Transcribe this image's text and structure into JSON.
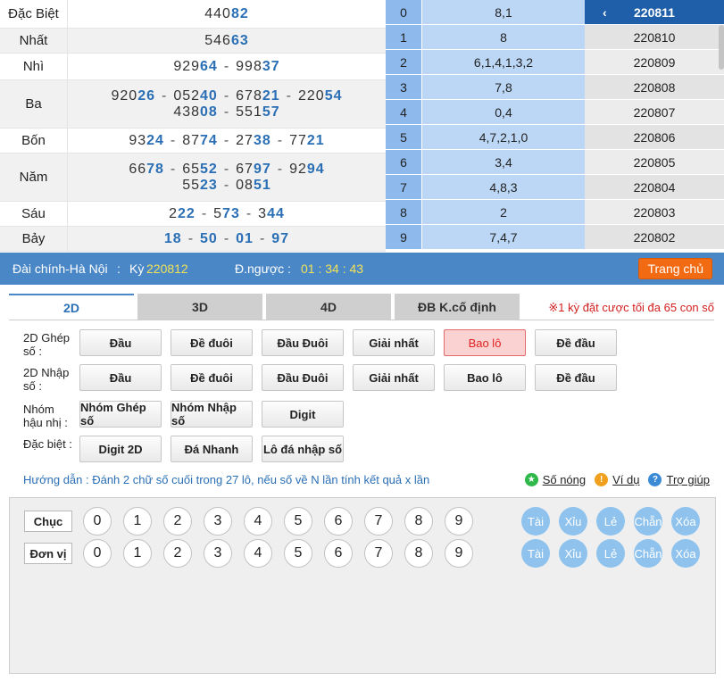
{
  "results": [
    {
      "name": "Đặc Biệt",
      "lines": [
        [
          {
            "pre": "440",
            "post": "82"
          }
        ]
      ]
    },
    {
      "name": "Nhất",
      "lines": [
        [
          {
            "pre": "546",
            "post": "63"
          }
        ]
      ]
    },
    {
      "name": "Nhì",
      "lines": [
        [
          {
            "pre": "929",
            "post": "64"
          },
          {
            "pre": "998",
            "post": "37"
          }
        ]
      ]
    },
    {
      "name": "Ba",
      "lines": [
        [
          {
            "pre": "920",
            "post": "26"
          },
          {
            "pre": "052",
            "post": "40"
          },
          {
            "pre": "678",
            "post": "21"
          },
          {
            "pre": "220",
            "post": "54"
          }
        ],
        [
          {
            "pre": "438",
            "post": "08"
          },
          {
            "pre": "551",
            "post": "57"
          }
        ]
      ]
    },
    {
      "name": "Bốn",
      "lines": [
        [
          {
            "pre": "93",
            "post": "24"
          },
          {
            "pre": "87",
            "post": "74"
          },
          {
            "pre": "27",
            "post": "38"
          },
          {
            "pre": "77",
            "post": "21"
          }
        ]
      ]
    },
    {
      "name": "Năm",
      "lines": [
        [
          {
            "pre": "66",
            "post": "78"
          },
          {
            "pre": "65",
            "post": "52"
          },
          {
            "pre": "67",
            "post": "97"
          },
          {
            "pre": "92",
            "post": "94"
          }
        ],
        [
          {
            "pre": "55",
            "post": "23"
          },
          {
            "pre": "08",
            "post": "51"
          }
        ]
      ]
    },
    {
      "name": "Sáu",
      "lines": [
        [
          {
            "pre": "2",
            "post": "22"
          },
          {
            "pre": "5",
            "post": "73"
          },
          {
            "pre": "3",
            "post": "44"
          }
        ]
      ]
    },
    {
      "name": "Bảy",
      "lines": [
        [
          {
            "pre": "",
            "post": "18"
          },
          {
            "pre": "",
            "post": "50"
          },
          {
            "pre": "",
            "post": "01"
          },
          {
            "pre": "",
            "post": "97"
          }
        ]
      ]
    }
  ],
  "loto": [
    {
      "head": "0",
      "tails": "8,1"
    },
    {
      "head": "1",
      "tails": "8"
    },
    {
      "head": "2",
      "tails": "6,1,4,1,3,2"
    },
    {
      "head": "3",
      "tails": "7,8"
    },
    {
      "head": "4",
      "tails": "0,4"
    },
    {
      "head": "5",
      "tails": "4,7,2,1,0"
    },
    {
      "head": "6",
      "tails": "3,4"
    },
    {
      "head": "7",
      "tails": "4,8,3"
    },
    {
      "head": "8",
      "tails": "2"
    },
    {
      "head": "9",
      "tails": "7,4,7"
    }
  ],
  "periods": [
    "220811",
    "220810",
    "220809",
    "220808",
    "220807",
    "220806",
    "220805",
    "220804",
    "220803",
    "220802"
  ],
  "period_chevron": "‹",
  "bar": {
    "station": "Đài chính-Hà Nội",
    "sep": ":",
    "ky_label": "Kỳ",
    "ky_value": "220812",
    "countdown_label": "Đ.ngược :",
    "countdown_value": "01 : 34 : 43",
    "home_button": "Trang chủ"
  },
  "tabs": [
    "2D",
    "3D",
    "4D",
    "ĐB K.cố định"
  ],
  "tab_note": "※1 kỳ đặt cược tối đa 65 con số",
  "groups": [
    {
      "label": "2D Ghép số :",
      "buttons": [
        "Đầu",
        "Đề đuôi",
        "Đầu Đuôi",
        "Giải nhất",
        "Bao lô",
        "Đề đầu"
      ]
    },
    {
      "label": "2D Nhập số :",
      "buttons": [
        "Đầu",
        "Đề đuôi",
        "Đầu Đuôi",
        "Giải nhất",
        "Bao lô",
        "Đề đầu"
      ]
    },
    {
      "label": "Nhóm hậu nhị :",
      "buttons": [
        "Nhóm Ghép số",
        "Nhóm Nhập số",
        "Digit"
      ]
    },
    {
      "label": "Đặc biệt :",
      "buttons": [
        "Digit 2D",
        "Đá Nhanh",
        "Lô đá nhập số"
      ]
    }
  ],
  "selected_button": "Bao lô",
  "guide": "Hướng dẫn : Đánh 2 chữ số cuối trong 27 lô, nếu số về N lần tính kết quả x lần",
  "links": [
    {
      "label": "Số nóng",
      "icon": "star-icon",
      "color": "#2eb84a",
      "glyph": "★"
    },
    {
      "label": "Ví dụ",
      "icon": "exclamation-icon",
      "color": "#f0a01c",
      "glyph": "!"
    },
    {
      "label": "Trợ giúp",
      "icon": "question-icon",
      "color": "#3a8ad6",
      "glyph": "?"
    }
  ],
  "picker": {
    "rows": [
      "Chục",
      "Đơn vị"
    ],
    "digits": [
      "0",
      "1",
      "2",
      "3",
      "4",
      "5",
      "6",
      "7",
      "8",
      "9"
    ],
    "quick": [
      "Tài",
      "Xỉu",
      "Lẻ",
      "Chẵn",
      "Xóa"
    ]
  }
}
